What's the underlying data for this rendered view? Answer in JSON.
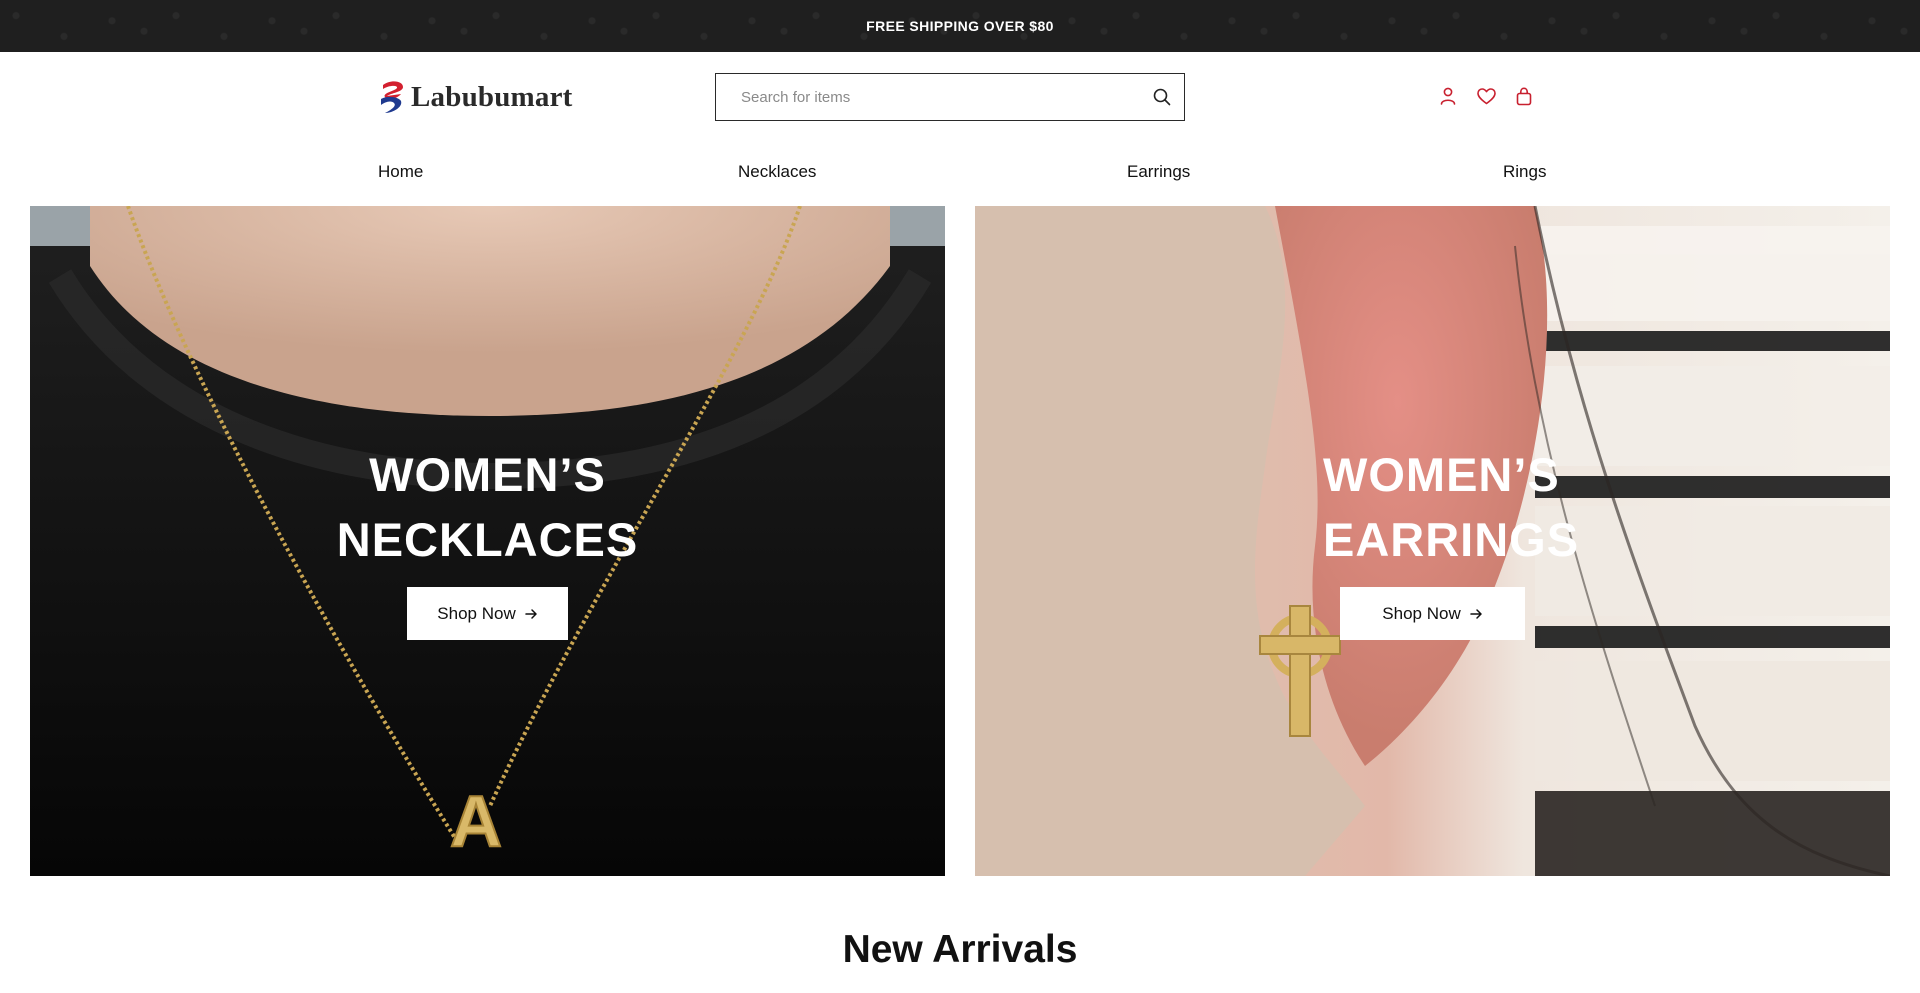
{
  "announcement": {
    "text": "FREE SHIPPING OVER $80"
  },
  "header": {
    "logo_text": "Labubumart",
    "search": {
      "placeholder": "Search for items",
      "value": ""
    },
    "icons": [
      "user-icon",
      "heart-icon",
      "bag-icon"
    ],
    "accent_color": "#c8202f"
  },
  "nav": {
    "items": [
      {
        "label": "Home"
      },
      {
        "label": "Necklaces"
      },
      {
        "label": "Earrings"
      },
      {
        "label": "Rings"
      }
    ]
  },
  "banners": [
    {
      "title_line1": "WOMEN’S",
      "title_line2": "NECKLACES",
      "button_label": "Shop Now",
      "button_icon": "arrow-right-icon"
    },
    {
      "title_line1": "WOMEN’S",
      "title_line2": "EARRINGS",
      "button_label": "Shop Now",
      "button_icon": "arrow-right-icon"
    }
  ],
  "sections": {
    "new_arrivals_title": "New Arrivals"
  }
}
